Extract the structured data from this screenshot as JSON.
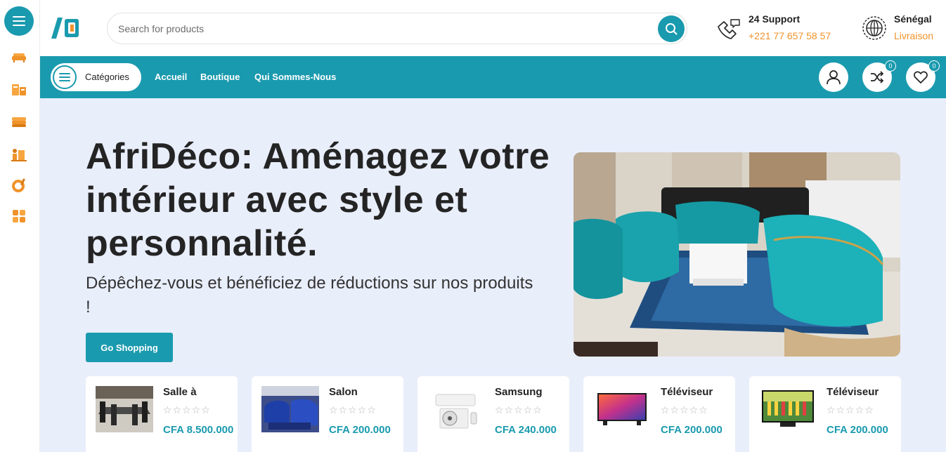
{
  "header": {
    "search_placeholder": "Search for products",
    "support_title": "24 Support",
    "support_phone": "+221 77 657  58 57",
    "region_title": "Sénégal",
    "region_sub": "Livraison"
  },
  "sidebar": {
    "icons": [
      "sofa-icon",
      "boxes-icon",
      "mattress-icon",
      "decor-icon",
      "kitchen-icon",
      "grid-icon"
    ]
  },
  "nav": {
    "categories_label": "Catégories",
    "links": [
      "Accueil",
      "Boutique",
      "Qui Sommes-Nous"
    ],
    "compare_count": "0",
    "wishlist_count": "0"
  },
  "hero": {
    "title": "AfriDéco: Aménagez votre intérieur avec style et personnalité.",
    "subtitle": "Dépêchez-vous et bénéficiez de réductions sur nos produits !",
    "cta": "Go Shopping"
  },
  "products": [
    {
      "name": "Salle à",
      "price": "CFA 8.500.000",
      "stars": "☆☆☆☆☆",
      "rating": 0
    },
    {
      "name": "Salon",
      "price": "CFA 200.000",
      "stars": "☆☆☆☆☆",
      "rating": 0
    },
    {
      "name": "Samsung",
      "price": "CFA 240.000",
      "stars": "☆☆☆☆☆",
      "rating": 0
    },
    {
      "name": "Téléviseur",
      "price": "CFA 200.000",
      "stars": "☆☆☆☆☆",
      "rating": 0
    },
    {
      "name": "Téléviseur",
      "price": "CFA 200.000",
      "stars": "☆☆☆☆☆",
      "rating": 0
    }
  ],
  "colors": {
    "accent": "#1a9aae",
    "orange": "#f0932b",
    "hero_bg": "#e9eefb"
  }
}
